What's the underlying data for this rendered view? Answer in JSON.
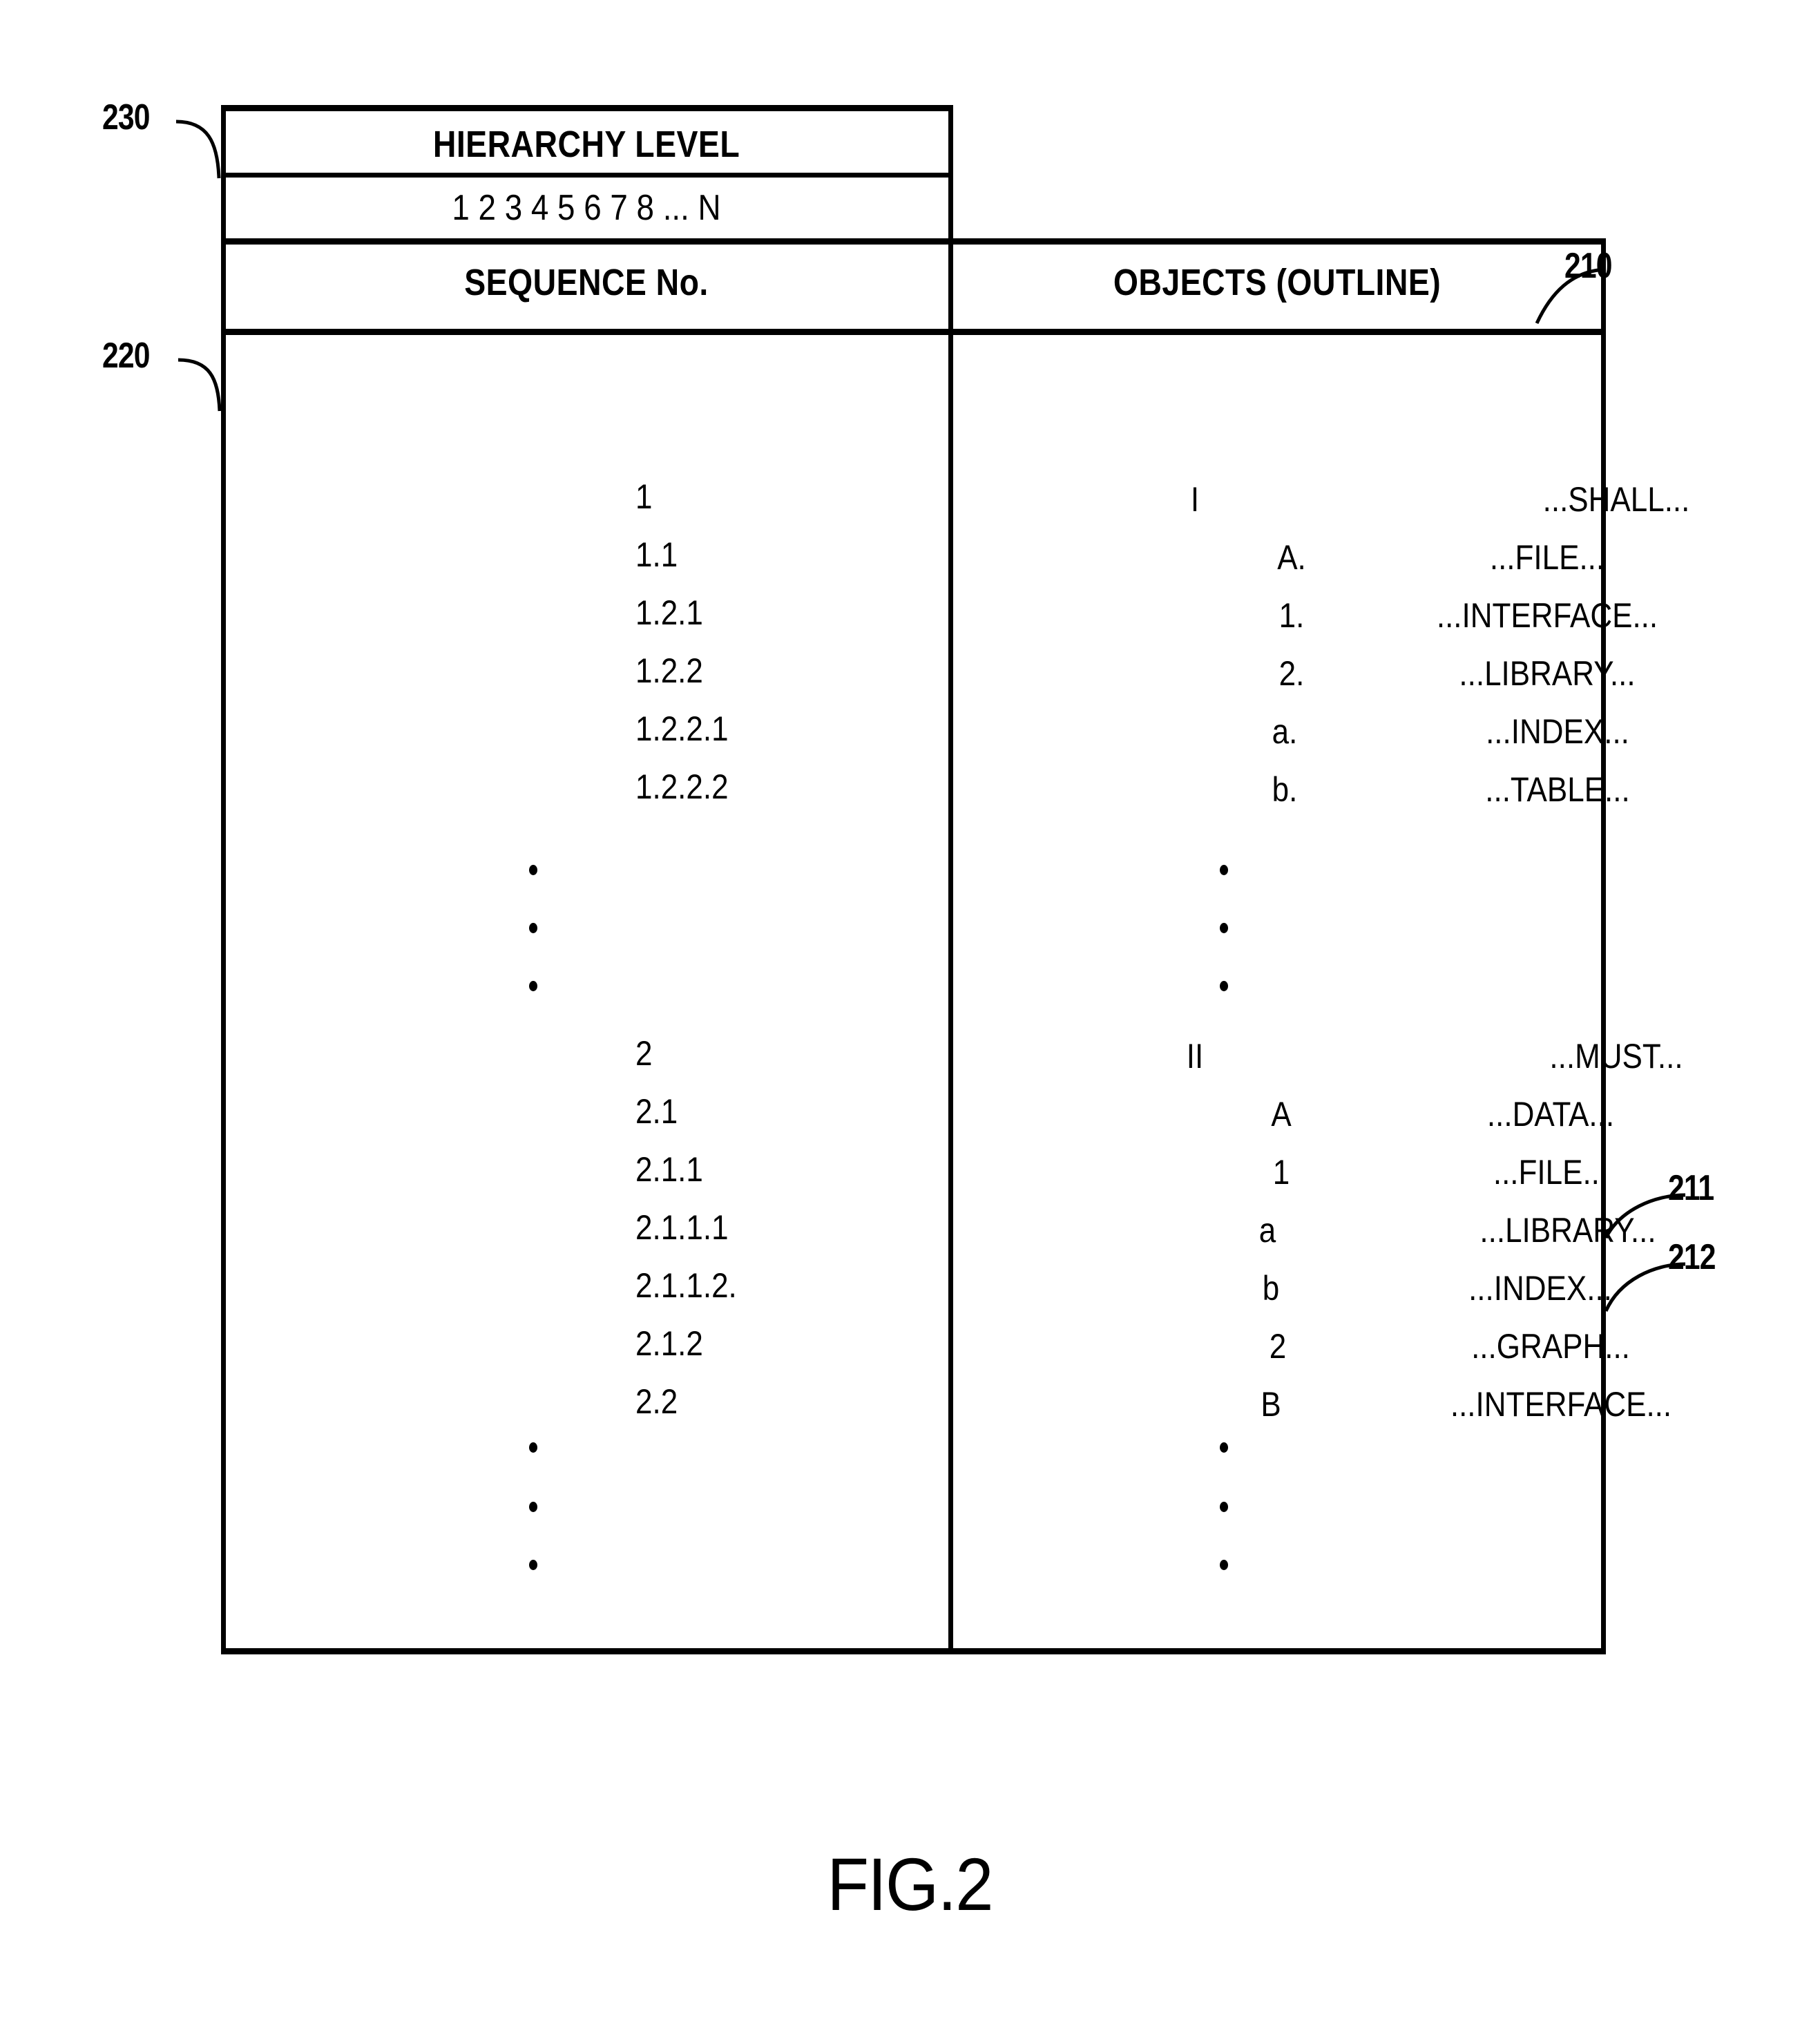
{
  "figure": {
    "caption": "FIG.2"
  },
  "callouts": [
    {
      "id": "callout-230",
      "label": "230"
    },
    {
      "id": "callout-220",
      "label": "220"
    },
    {
      "id": "callout-210",
      "label": "210"
    },
    {
      "id": "callout-211",
      "label": "211"
    },
    {
      "id": "callout-212",
      "label": "212"
    }
  ],
  "table": {
    "hierarchy_header": "HIERARCHY LEVEL",
    "hierarchy_levels": "1 2 3 4 5 6 7 8 ... N",
    "sequence_header": "SEQUENCE No.",
    "objects_header": "OBJECTS (OUTLINE)",
    "ellipsis_glyph": "·",
    "rows": [
      {
        "sequence": "1",
        "object_label": "I",
        "object_content": "...SHALL..."
      },
      {
        "sequence": "1.1",
        "object_label": "A.",
        "object_content": "...FILE..."
      },
      {
        "sequence": "1.2.1",
        "object_label": "1.",
        "object_content": "...INTERFACE..."
      },
      {
        "sequence": "1.2.2",
        "object_label": "2.",
        "object_content": "...LIBRARY..."
      },
      {
        "sequence": "1.2.2.1",
        "object_label": "a.",
        "object_content": "...INDEX..."
      },
      {
        "sequence": "1.2.2.2",
        "object_label": "b.",
        "object_content": "...TABLE..."
      }
    ],
    "rows_group2": [
      {
        "sequence": "2",
        "object_label": "II",
        "object_content": "...MUST..."
      },
      {
        "sequence": "2.1",
        "object_label": "A",
        "object_content": "...DATA..."
      },
      {
        "sequence": "2.1.1",
        "object_label": "1",
        "object_content": "...FILE..."
      },
      {
        "sequence": "2.1.1.1",
        "object_label": "a",
        "object_content": "...LIBRARY..."
      },
      {
        "sequence": "2.1.1.2.",
        "object_label": "b",
        "object_content": "...INDEX..."
      },
      {
        "sequence": "2.1.2",
        "object_label": "2",
        "object_content": "...GRAPH..."
      },
      {
        "sequence": "2.2",
        "object_label": "B",
        "object_content": "...INTERFACE..."
      }
    ]
  },
  "colors": {
    "ink": "#000000",
    "paper": "#ffffff"
  }
}
